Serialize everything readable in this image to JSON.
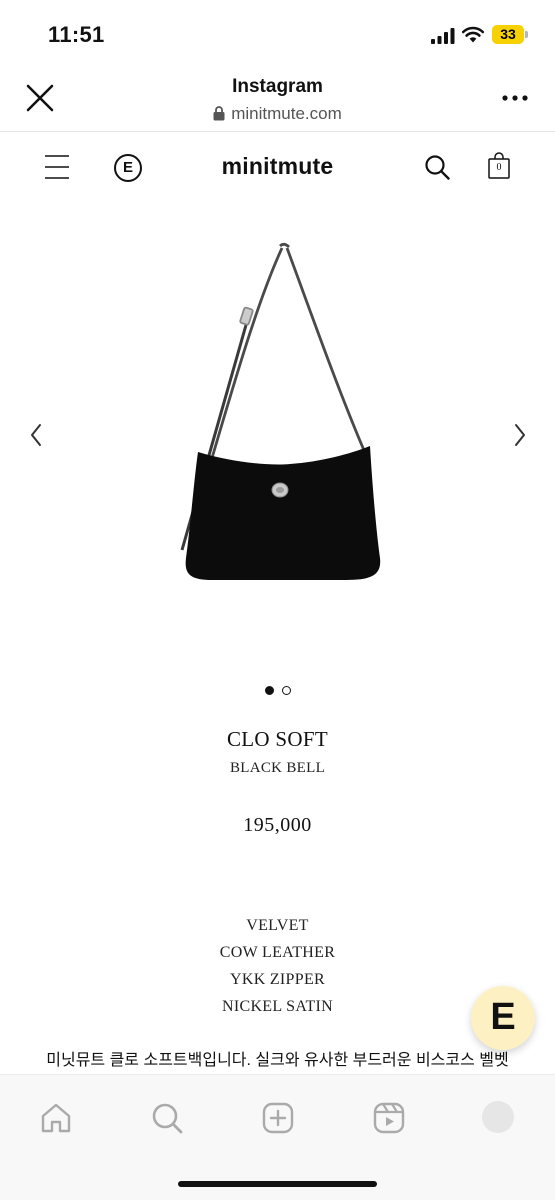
{
  "status_bar": {
    "time": "11:51",
    "battery": "33"
  },
  "browser": {
    "title": "Instagram",
    "url": "minitmute.com"
  },
  "site": {
    "logo": "minitmute",
    "e_badge": "E",
    "cart_count": "0"
  },
  "product": {
    "name": "CLO SOFT",
    "color": "BLACK BELL",
    "price": "195,000",
    "materials": [
      "VELVET",
      "COW LEATHER",
      "YKK ZIPPER",
      "NICKEL SATIN"
    ],
    "description": "미닛뮤트 클로 소프트백입니다. 실크와 유사한 부드러운 비스코스 벨벳"
  },
  "carousel": {
    "total": 2,
    "active_index": 0
  },
  "chat": {
    "label": "E"
  },
  "icons": {
    "close": "close-icon",
    "more": "more-icon",
    "lock": "lock-icon",
    "menu": "menu-icon",
    "search": "search-icon",
    "cart": "shopping-bag-icon",
    "prev": "chevron-left-icon",
    "next": "chevron-right-icon",
    "home": "home-icon",
    "explore": "search-icon",
    "create": "plus-square-icon",
    "reels": "reels-icon",
    "profile": "profile-avatar"
  },
  "colors": {
    "battery": "#f7d200",
    "chat_button": "#fdf1c4",
    "text": "#111111"
  }
}
